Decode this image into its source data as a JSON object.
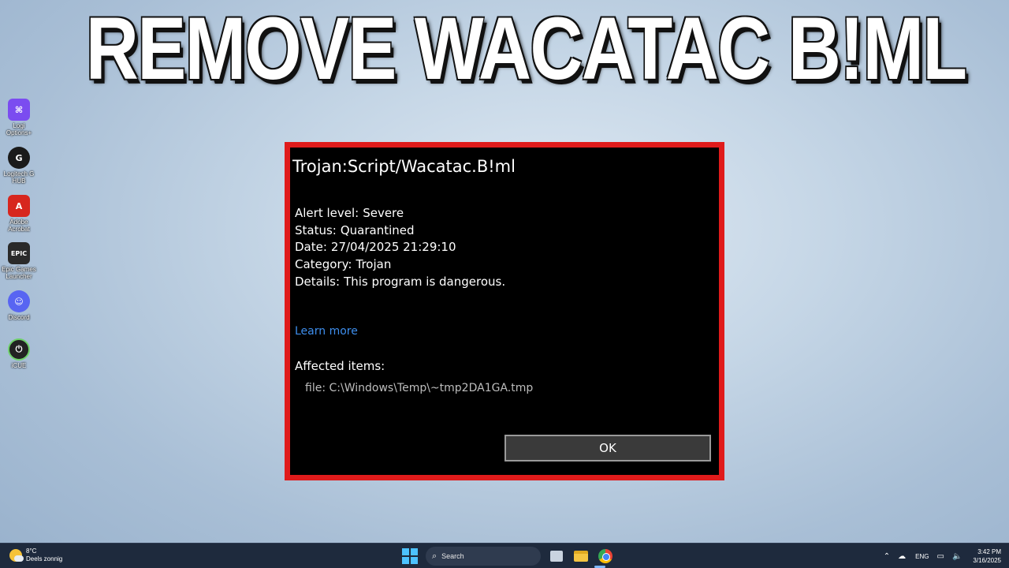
{
  "thumbnail": {
    "title": "REMOVE WACATAC B!ML"
  },
  "desktop_icons": [
    {
      "label": "Logi Options+",
      "icon": "logi-options-icon",
      "color": "#7b4cf0"
    },
    {
      "label": "Logitech G HUB",
      "icon": "logitech-g-hub-icon",
      "color": "#1a1a1a"
    },
    {
      "label": "Adobe Acrobat",
      "icon": "adobe-acrobat-icon",
      "color": "#d7261e"
    },
    {
      "label": "Epic Games Launcher",
      "icon": "epic-games-icon",
      "color": "#2a2a2a"
    },
    {
      "label": "Discord",
      "icon": "discord-icon",
      "color": "#5865f2"
    },
    {
      "label": "iCUE",
      "icon": "icue-icon",
      "color": "#222222"
    }
  ],
  "dialog": {
    "title": "Trojan:Script/Wacatac.B!ml",
    "fields": [
      {
        "label": "Alert level:",
        "value": "Severe"
      },
      {
        "label": "Status:",
        "value": "Quarantined"
      },
      {
        "label": "Date:",
        "value": "27/04/2025 21:29:10"
      },
      {
        "label": "Category:",
        "value": "Trojan"
      },
      {
        "label": "Details:",
        "value": "This program is dangerous."
      }
    ],
    "learn_more": "Learn more",
    "affected_label": "Affected items:",
    "affected_file": "file: C:\\Windows\\Temp\\~tmp2DA1GA.tmp",
    "ok_label": "OK",
    "border_color": "#e01b1b",
    "link_color": "#3e8eed"
  },
  "taskbar": {
    "weather_temp": "8°C",
    "weather_desc": "Deels zonnig",
    "search_label": "Search",
    "language": "ENG",
    "time": "3:42 PM",
    "date": "3/16/2025"
  }
}
